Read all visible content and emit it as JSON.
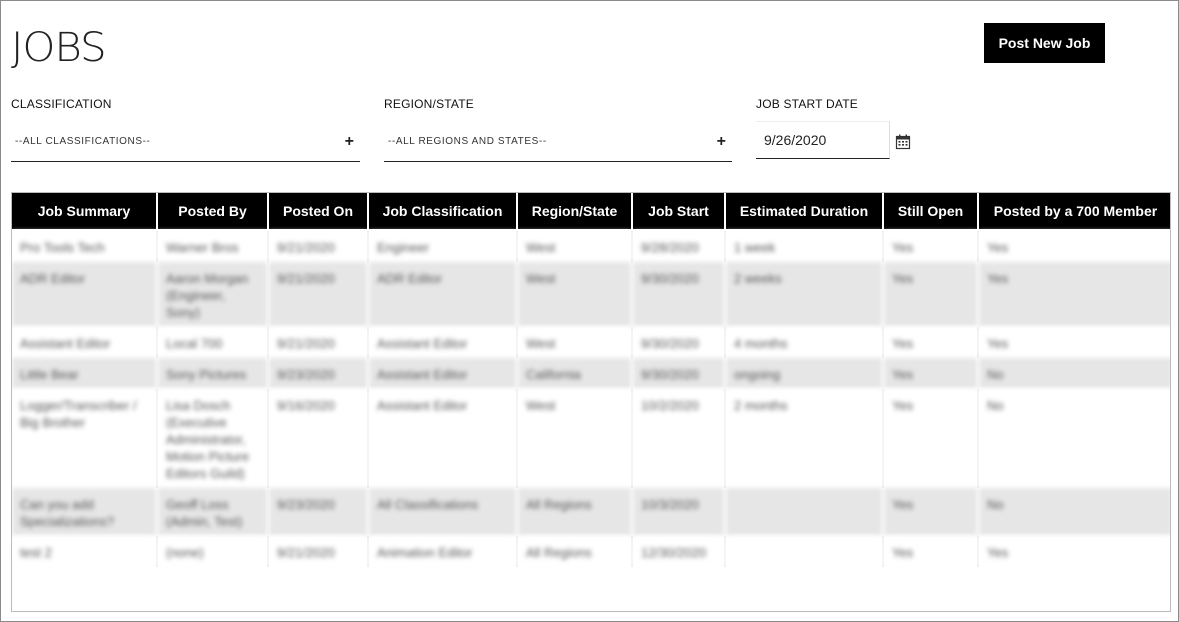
{
  "header": {
    "title": "JOBS",
    "post_button": "Post New Job"
  },
  "filters": {
    "classification": {
      "label": "CLASSIFICATION",
      "value": "--ALL CLASSIFICATIONS--"
    },
    "region": {
      "label": "REGION/STATE",
      "value": "--ALL REGIONS AND STATES--"
    },
    "start_date": {
      "label": "JOB START DATE",
      "value": "9/26/2020"
    }
  },
  "table": {
    "columns": [
      "Job Summary",
      "Posted By",
      "Posted On",
      "Job Classification",
      "Region/State",
      "Job Start",
      "Estimated Duration",
      "Still Open",
      "Posted by a 700 Member"
    ],
    "rows": [
      [
        "Pro Tools Tech",
        "Warner Bros",
        "9/21/2020",
        "Engineer",
        "West",
        "9/28/2020",
        "1 week",
        "Yes",
        "Yes"
      ],
      [
        "ADR Editor",
        "Aaron Morgan (Engineer, Sony)",
        "9/21/2020",
        "ADR Editor",
        "West",
        "9/30/2020",
        "2 weeks",
        "Yes",
        "Yes"
      ],
      [
        "Assistant Editor",
        "Local 700",
        "9/21/2020",
        "Assistant Editor",
        "West",
        "9/30/2020",
        "4 months",
        "Yes",
        "Yes"
      ],
      [
        "Little Bear",
        "Sony Pictures",
        "9/23/2020",
        "Assistant Editor",
        "California",
        "9/30/2020",
        "ongoing",
        "Yes",
        "No"
      ],
      [
        "Logger/Transcriber / Big Brother",
        "Lisa Dosch (Executive Administrator, Motion Picture Editors Guild)",
        "9/16/2020",
        "Assistant Editor",
        "West",
        "10/2/2020",
        "2 months",
        "Yes",
        "No"
      ],
      [
        "Can you add Specializations?",
        "Geoff Loss (Admin, Test)",
        "9/23/2020",
        "All Classifications",
        "All Regions",
        "10/3/2020",
        "",
        "Yes",
        "No"
      ],
      [
        "test 2",
        "(none)",
        "9/21/2020",
        "Animation Editor",
        "All Regions",
        "12/30/2020",
        "",
        "Yes",
        "Yes"
      ]
    ]
  },
  "icons": {
    "add": "plus-icon",
    "calendar": "calendar-icon"
  }
}
